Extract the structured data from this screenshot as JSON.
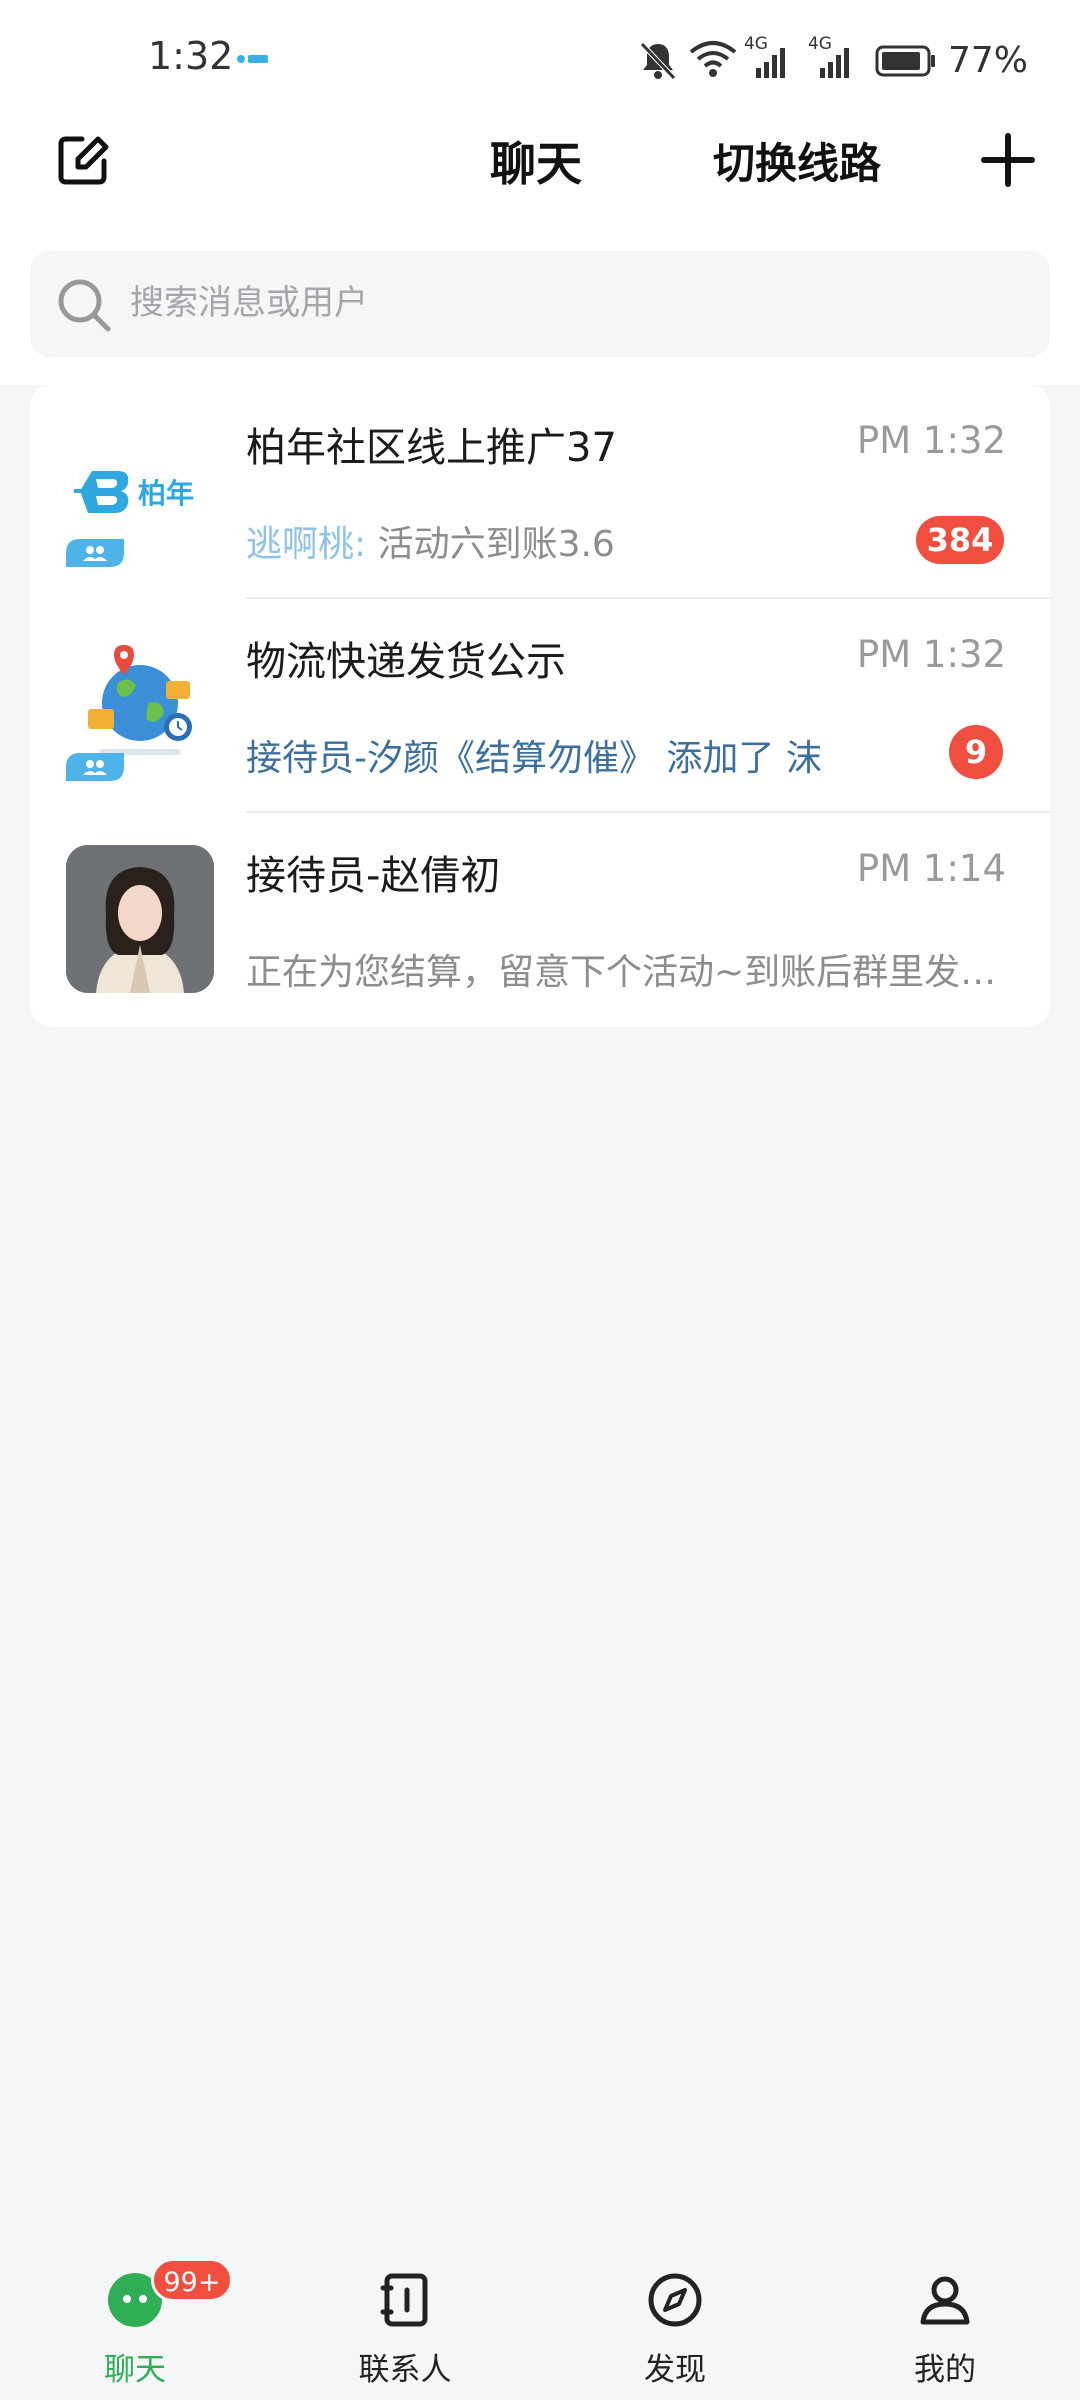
{
  "status_bar": {
    "time": "1:32",
    "icons": [
      "bell-muted-icon",
      "wifi-icon",
      "signal-4g-icon",
      "signal-4g-icon",
      "battery-icon"
    ],
    "network_label_1": "4G",
    "network_label_2": "4G",
    "battery_percent": "77%"
  },
  "header": {
    "title": "聊天",
    "switch_route_label": "切换线路",
    "edit_icon": "edit-icon",
    "add_icon": "plus-icon"
  },
  "search": {
    "placeholder": "搜索消息或用户",
    "icon": "search-icon"
  },
  "chats": [
    {
      "name": "柏年社区线上推广37",
      "time": "PM 1:32",
      "sender": "逃啊桃:",
      "preview": " 活动六到账3.6",
      "unread": "384",
      "avatar_logo_text": "柏年",
      "is_group": true
    },
    {
      "name": "物流快递发货公示",
      "time": "PM 1:32",
      "preview": "接待员-汐颜《结算勿催》 添加了 沫",
      "unread": "9",
      "is_group": true
    },
    {
      "name": "接待员-赵倩初",
      "time": "PM 1:14",
      "preview": "正在为您结算，留意下个活动~到账后群里发红包",
      "is_group": false
    }
  ],
  "bottom_nav": {
    "items": [
      {
        "label": "聊天",
        "icon": "chat-bubble-icon",
        "active": true,
        "badge": "99+"
      },
      {
        "label": "联系人",
        "icon": "contacts-book-icon",
        "active": false
      },
      {
        "label": "发现",
        "icon": "compass-icon",
        "active": false
      },
      {
        "label": "我的",
        "icon": "user-icon",
        "active": false
      }
    ]
  },
  "colors": {
    "accent_green": "#2fae55",
    "badge_red": "#f04e3e",
    "sender_blue": "#8fc3e6",
    "link_blue": "#3c6f9d",
    "background": "#f5f6f8"
  }
}
